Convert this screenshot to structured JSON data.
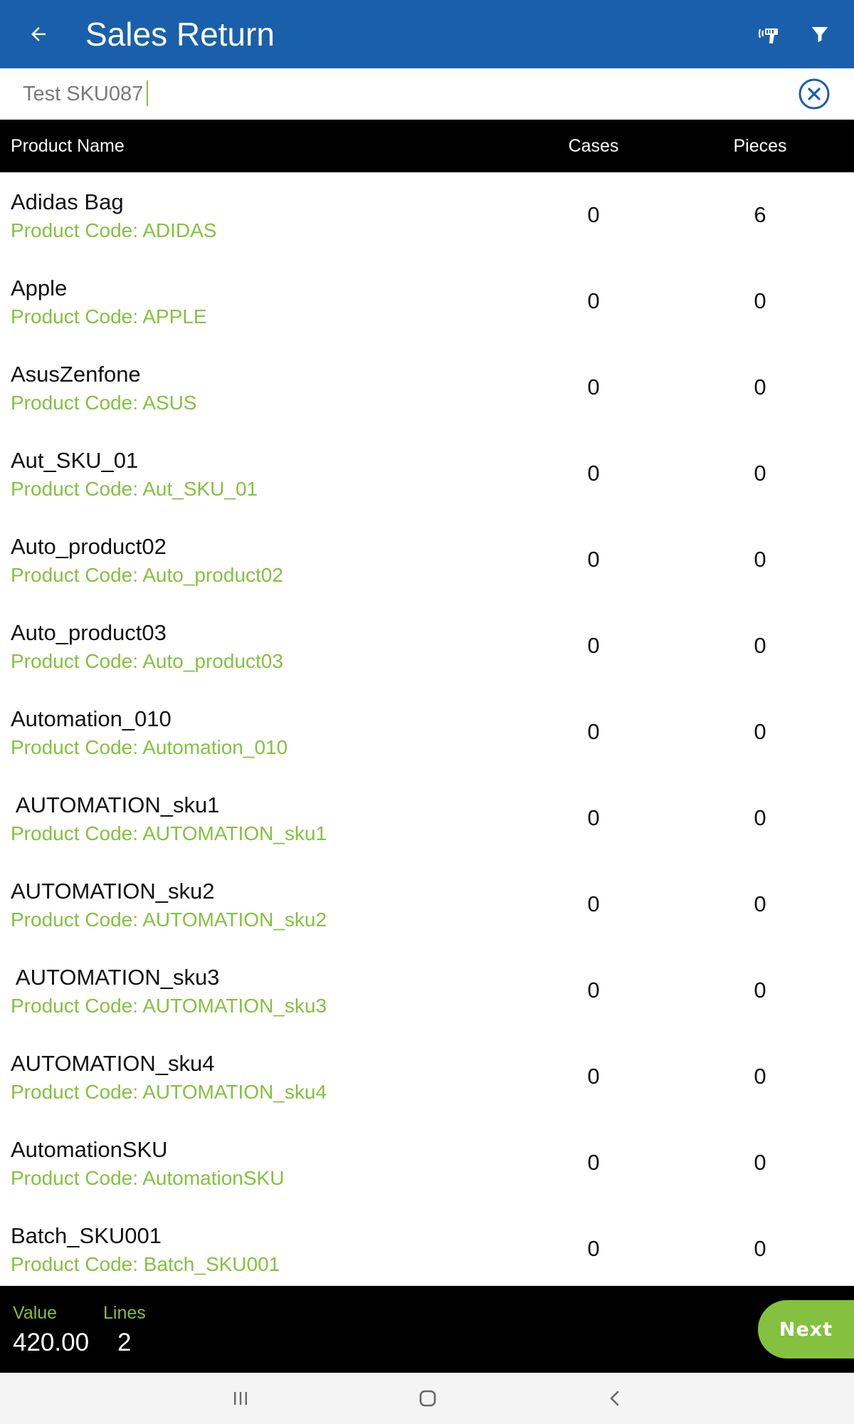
{
  "appbar": {
    "title": "Sales Return",
    "back_icon": "arrow-left-icon",
    "scanner_icon": "barcode-scanner-icon",
    "filter_icon": "filter-icon",
    "background": "#1a5fab"
  },
  "search": {
    "value": "Test SKU087",
    "clear_icon": "clear-circle-icon"
  },
  "table": {
    "headers": {
      "name": "Product Name",
      "cases": "Cases",
      "pieces": "Pieces"
    },
    "rows": [
      {
        "name": "Adidas Bag",
        "code": "Product Code: ADIDAS",
        "cases": "0",
        "pieces": "6"
      },
      {
        "name": "Apple",
        "code": "Product Code: APPLE",
        "cases": "0",
        "pieces": "0"
      },
      {
        "name": "AsusZenfone",
        "code": "Product Code: ASUS",
        "cases": "0",
        "pieces": "0"
      },
      {
        "name": "Aut_SKU_01",
        "code": "Product Code: Aut_SKU_01",
        "cases": "0",
        "pieces": "0"
      },
      {
        "name": "Auto_product02",
        "code": "Product Code: Auto_product02",
        "cases": "0",
        "pieces": "0"
      },
      {
        "name": "Auto_product03",
        "code": "Product Code: Auto_product03",
        "cases": "0",
        "pieces": "0"
      },
      {
        "name": "Automation_010",
        "code": "Product Code: Automation_010",
        "cases": "0",
        "pieces": "0"
      },
      {
        "name": " AUTOMATION_sku1",
        "code": "Product Code: AUTOMATION_sku1",
        "cases": "0",
        "pieces": "0"
      },
      {
        "name": "AUTOMATION_sku2",
        "code": "Product Code: AUTOMATION_sku2",
        "cases": "0",
        "pieces": "0"
      },
      {
        "name": " AUTOMATION_sku3",
        "code": "Product Code: AUTOMATION_sku3",
        "cases": "0",
        "pieces": "0"
      },
      {
        "name": "AUTOMATION_sku4",
        "code": "Product Code: AUTOMATION_sku4",
        "cases": "0",
        "pieces": "0"
      },
      {
        "name": "AutomationSKU",
        "code": "Product Code: AutomationSKU",
        "cases": "0",
        "pieces": "0"
      },
      {
        "name": "Batch_SKU001",
        "code": "Product Code: Batch_SKU001",
        "cases": "0",
        "pieces": "0"
      }
    ]
  },
  "footer": {
    "value_label": "Value",
    "value": "420.00",
    "lines_label": "Lines",
    "lines": "2",
    "next_label": "Next",
    "accent": "#84c13f"
  },
  "system_nav": {
    "recents_icon": "recents-icon",
    "home_icon": "home-icon",
    "back_icon": "nav-back-icon"
  }
}
